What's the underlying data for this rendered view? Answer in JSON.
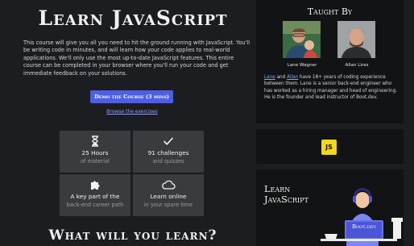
{
  "main": {
    "title": "Learn JavaScript",
    "description": "This course will give you all you need to hit the ground running with JavaScript. You'll be writing code in minutes, and will learn how your code applies to real-world applications. We'll only use the most up-to-date JavaScript features. This entire course can be completed in your browser where you'll run your code and get immediate feedback on your solutions.",
    "demo_button": "Demo the Course (3 mins)",
    "browse_link": "Browse the exercises",
    "features": [
      {
        "icon": "hourglass-icon",
        "line1": "25 Hours",
        "line2": "of material"
      },
      {
        "icon": "checkmark-icon",
        "line1": "91 challenges",
        "line2": "and quizzes"
      },
      {
        "icon": "puzzle-icon",
        "line1": "A key part of the",
        "line2": "back-end career path"
      },
      {
        "icon": "cloud-icon",
        "line1": "Learn online",
        "line2": "in your spare time"
      }
    ],
    "section_heading": "What will you learn?"
  },
  "sidebar": {
    "taught_by_title": "Taught By",
    "instructors": [
      {
        "name": "Lane Wagner"
      },
      {
        "name": "Allan Lires"
      }
    ],
    "bio_link_1": "Lane",
    "bio_and": " and ",
    "bio_link_2": "Allan",
    "bio_rest": " have 18+ years of coding experience between them. Lane is a senior back-end engineer who has worked as a hiring manager and head of engineering. He is the founder and lead instructor of Boot.dev.",
    "js_logo_text": "JS",
    "promo_title": "Learn JavaScript",
    "promo_brand": "Boot.dev"
  },
  "colors": {
    "accent": "#4e5fe3",
    "link": "#8ea0ff",
    "js_yellow": "#f3d620",
    "card_bg": "#3a3b3f",
    "page_bg": "#1c1d20",
    "panel_bg": "#121314"
  }
}
